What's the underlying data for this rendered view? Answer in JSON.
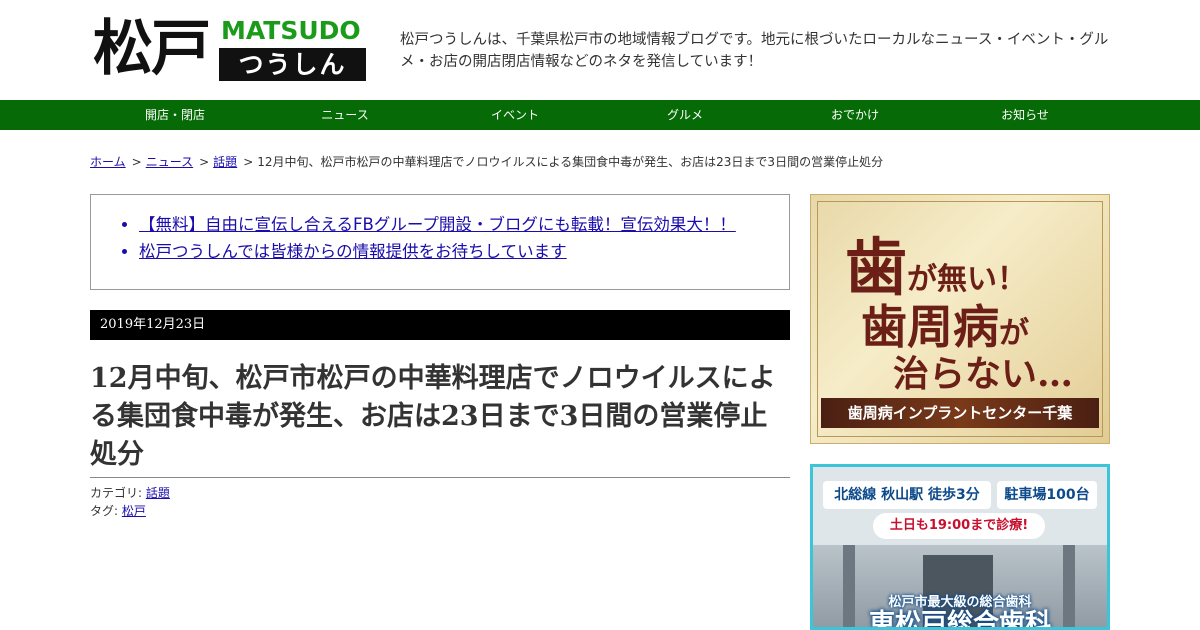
{
  "logo": {
    "kanji": "松戸",
    "romaji": "MATSUDO",
    "kana": "つうしん"
  },
  "tagline": "松戸つうしんは、千葉県松戸市の地域情報ブログです。地元に根づいたローカルなニュース・イベント・グルメ・お店の開店閉店情報などのネタを発信しています！",
  "nav": [
    "開店・閉店",
    "ニュース",
    "イベント",
    "グルメ",
    "おでかけ",
    "お知らせ"
  ],
  "breadcrumb": {
    "home": "ホーム",
    "news": "ニュース",
    "topic": "話題",
    "current": "12月中旬、松戸市松戸の中華料理店でノロウイルスによる集団食中毒が発生、お店は23日まで3日間の営業停止処分",
    "separator": ">"
  },
  "notices": [
    "【無料】自由に宣伝し合えるFBグループ開設・ブログにも転載！宣伝効果大！！",
    "松戸つうしんでは皆様からの情報提供をお待ちしています"
  ],
  "post": {
    "date": "2019年12月23日",
    "title": "12月中旬、松戸市松戸の中華料理店でノロウイルスによる集団食中毒が発生、お店は23日まで3日間の営業停止処分",
    "category_label": "カテゴリ:",
    "category": "話題",
    "tag_label": "タグ:",
    "tag": "松戸"
  },
  "ad1": {
    "line1_big": "歯",
    "line1_rest": "が無い！",
    "line2_big": "歯周病",
    "line2_rest": "が",
    "line3": "治らない…",
    "band": "歯周病インプラントセンター千葉"
  },
  "ad2": {
    "pill1": "北総線 秋山駅 徒歩3分",
    "pill2": "駐車場100台",
    "sub": "土日も19:00まで診療!",
    "caption": "松戸市最大級の総合歯科",
    "big": "東松戸総合歯科"
  },
  "colors": {
    "nav_bg": "#066b06",
    "logo_green": "#1a9b1a",
    "link": "#1a0dab",
    "date_bg": "#000000"
  }
}
